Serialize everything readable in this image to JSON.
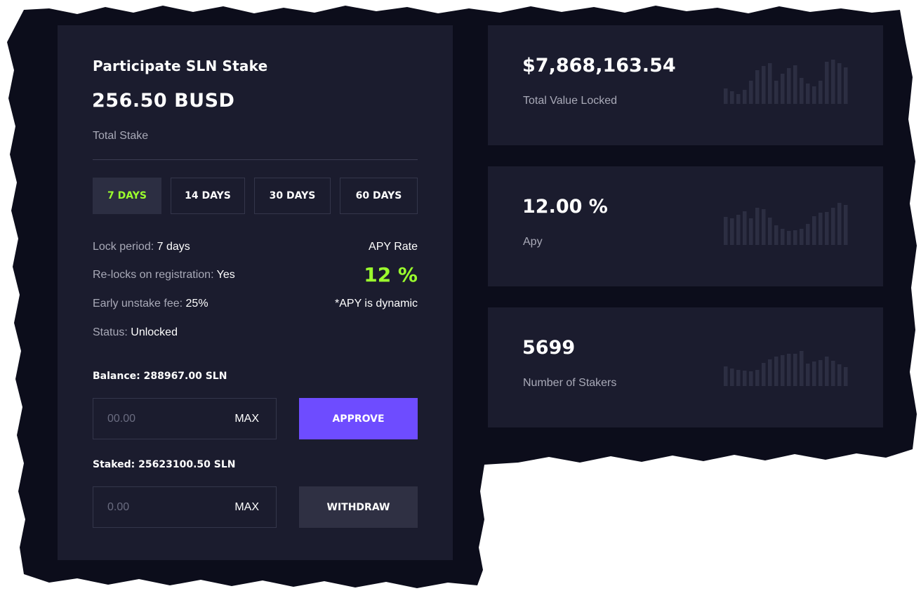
{
  "stake": {
    "title": "Participate SLN Stake",
    "amount": "256.50 BUSD",
    "amount_label": "Total Stake",
    "tabs": [
      {
        "label": "7 DAYS",
        "active": true
      },
      {
        "label": "14 DAYS",
        "active": false
      },
      {
        "label": "30 DAYS",
        "active": false
      },
      {
        "label": "60 DAYS",
        "active": false
      }
    ],
    "info": [
      {
        "label": "Lock period:",
        "value": "7 days"
      },
      {
        "label": "Re-locks on registration:",
        "value": "Yes"
      },
      {
        "label": "Early unstake fee:",
        "value": "25%"
      },
      {
        "label": "Status:",
        "value": "Unlocked"
      }
    ],
    "apy_rate_label": "APY Rate",
    "apy_rate_value": "12 %",
    "apy_note": "*APY is dynamic",
    "balance_label": "Balance: 288967.00 SLN",
    "stake_input": {
      "placeholder": "00.00",
      "max_label": "MAX"
    },
    "approve_label": "APPROVE",
    "staked_label": "Staked: 25623100.50 SLN",
    "withdraw_input": {
      "placeholder": "0.00",
      "max_label": "MAX"
    },
    "withdraw_label": "WITHDRAW"
  },
  "stats": [
    {
      "value": "$7,868,163.54",
      "label": "Total Value Locked",
      "sparkline": [
        22,
        18,
        14,
        20,
        33,
        48,
        54,
        58,
        33,
        43,
        51,
        55,
        37,
        29,
        25,
        33,
        60,
        63,
        58,
        52
      ]
    },
    {
      "value": "12.00 %",
      "label": "Apy",
      "sparkline": [
        40,
        38,
        43,
        48,
        38,
        53,
        51,
        39,
        28,
        23,
        20,
        21,
        23,
        30,
        41,
        46,
        47,
        53,
        60,
        57
      ]
    },
    {
      "value": "5699",
      "label": "Number of Stakers",
      "sparkline": [
        28,
        25,
        23,
        22,
        21,
        23,
        33,
        38,
        42,
        44,
        46,
        46,
        50,
        32,
        35,
        37,
        42,
        36,
        31,
        27
      ]
    }
  ],
  "colors": {
    "panel": "#1b1c2e",
    "accent_green": "#9bff2d",
    "accent_purple": "#6e4cff",
    "sparkline_bar": "#2c2e42"
  }
}
